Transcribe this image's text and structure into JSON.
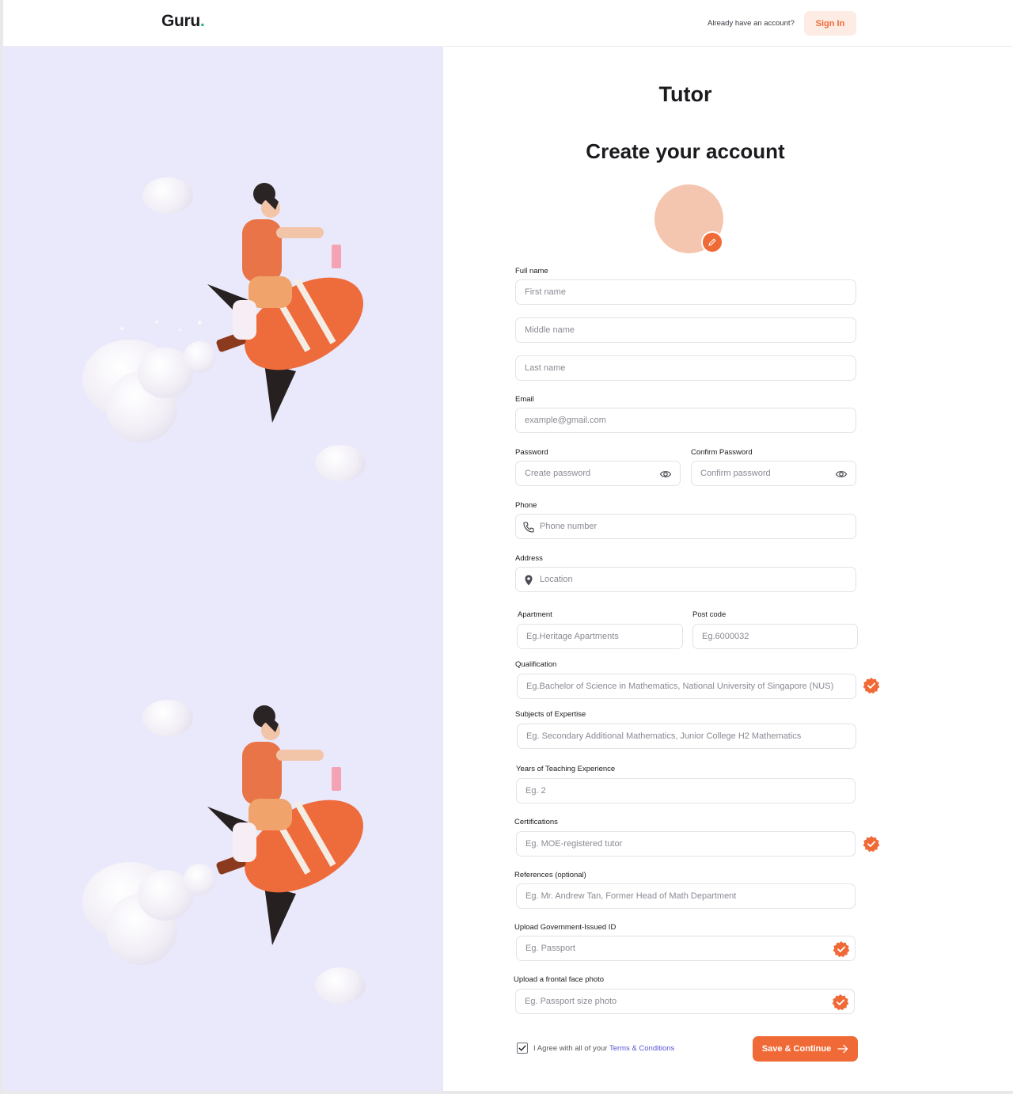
{
  "header": {
    "logo": "Guru",
    "logo_dot": ".",
    "have_account": "Already have an account?",
    "sign_in": "Sign In"
  },
  "form": {
    "role": "Tutor",
    "title": "Create your account",
    "full_name_label": "Full name",
    "first_name_ph": "First name",
    "middle_name_ph": "Middle name",
    "last_name_ph": "Last name",
    "email_label": "Email",
    "email_ph": "example@gmail.com",
    "password_label": "Password",
    "password_ph": "Create password",
    "confirm_label": "Confirm Password",
    "confirm_ph": "Confirm password",
    "phone_label": "Phone",
    "phone_ph": "Phone number",
    "address_label": "Address",
    "address_ph": "Location",
    "apartment_label": "Apartment",
    "apartment_ph": "Eg.Heritage Apartments",
    "postcode_label": "Post code",
    "postcode_ph": "Eg.6000032",
    "qualification_label": "Qualification",
    "qualification_ph": "Eg.Bachelor of Science in Mathematics, National University of Singapore (NUS)",
    "subjects_label": "Subjects of Expertise",
    "subjects_ph": "Eg. Secondary Additional Mathematics, Junior College H2 Mathematics",
    "years_label": "Years of Teaching Experience",
    "years_ph": "Eg. 2",
    "certs_label": "Certifications",
    "certs_ph": "Eg. MOE-registered tutor",
    "refs_label": "References (optional)",
    "refs_ph": "Eg. Mr. Andrew Tan, Former Head of Math Department",
    "gov_id_label": "Upload Government-Issued ID",
    "gov_id_ph": "Eg. Passport",
    "face_label": "Upload a frontal face photo",
    "face_ph": "Eg. Passport size photo",
    "agree_text": "I Agree with all of your ",
    "terms_link": "Terms & Conditions",
    "agree_checked": true,
    "save_button": "Save & Continue"
  },
  "icons": {
    "avatar_edit": "pencil-icon",
    "password_toggle": "eye-icon",
    "phone": "phone-icon",
    "location": "map-pin-icon",
    "verified": "verified-badge-icon",
    "save_arrow": "arrow-right-icon"
  },
  "colors": {
    "accent": "#f06a37",
    "accent_light": "#fdece4",
    "avatar": "#f5c6af",
    "left_panel": "#e9e9fb",
    "logo_dot": "#1fb37a",
    "link": "#5b55d8"
  }
}
